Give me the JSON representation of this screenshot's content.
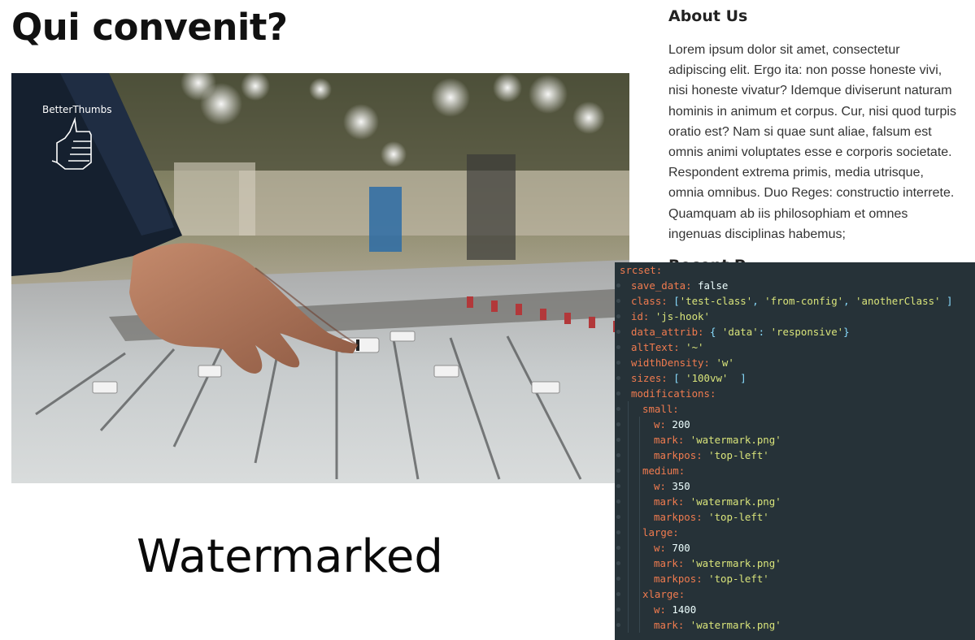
{
  "main": {
    "title": "Qui convenit?",
    "caption": "Watermarked",
    "image": {
      "watermark_label": "BetterThumbs",
      "watermark_icon": "thumbs-up-icon"
    }
  },
  "sidebar": {
    "about_title": "About Us",
    "about_text": "Lorem ipsum dolor sit amet, consectetur adipiscing elit. Ergo ita: non posse honeste vivi, nisi honeste vivatur? Idemque diviserunt naturam hominis in animum et corpus. Cur, nisi quod turpis oratio est? Nam si quae sunt aliae, falsum est omnis animi voluptates esse e corporis societate. Respondent extrema primis, media utrisque, omnia omnibus. Duo Reges: constructio interrete. Quamquam ab iis philosophiam et omnes ingenuas disciplinas habemus;",
    "second_title_partial": "Recent P"
  },
  "code": {
    "colors": {
      "background": "#263238",
      "key": "#f07b4f",
      "string": "#d9e47a",
      "punctuation": "#89ddff",
      "plain": "#eeffff"
    },
    "lines": [
      {
        "indent": 0,
        "segments": [
          {
            "t": "srcset:",
            "c": "k"
          }
        ]
      },
      {
        "indent": 1,
        "segments": [
          {
            "t": "save_data: ",
            "c": "k"
          },
          {
            "t": "false",
            "c": "v"
          }
        ]
      },
      {
        "indent": 1,
        "segments": [
          {
            "t": "class: ",
            "c": "k"
          },
          {
            "t": "[",
            "c": "p"
          },
          {
            "t": "'test-class'",
            "c": "s"
          },
          {
            "t": ", ",
            "c": "p"
          },
          {
            "t": "'from-config'",
            "c": "s"
          },
          {
            "t": ", ",
            "c": "p"
          },
          {
            "t": "'anotherClass'",
            "c": "s"
          },
          {
            "t": " ]",
            "c": "p"
          }
        ]
      },
      {
        "indent": 1,
        "segments": [
          {
            "t": "id: ",
            "c": "k"
          },
          {
            "t": "'js-hook'",
            "c": "s"
          }
        ]
      },
      {
        "indent": 1,
        "segments": [
          {
            "t": "data_attrib: ",
            "c": "k"
          },
          {
            "t": "{ ",
            "c": "p"
          },
          {
            "t": "'data'",
            "c": "s"
          },
          {
            "t": ": ",
            "c": "p"
          },
          {
            "t": "'responsive'",
            "c": "s"
          },
          {
            "t": "}",
            "c": "p"
          }
        ]
      },
      {
        "indent": 1,
        "segments": [
          {
            "t": "altText: ",
            "c": "k"
          },
          {
            "t": "'~'",
            "c": "s"
          }
        ]
      },
      {
        "indent": 1,
        "segments": [
          {
            "t": "widthDensity: ",
            "c": "k"
          },
          {
            "t": "'w'",
            "c": "s"
          }
        ]
      },
      {
        "indent": 1,
        "segments": [
          {
            "t": "sizes: ",
            "c": "k"
          },
          {
            "t": "[ ",
            "c": "p"
          },
          {
            "t": "'100vw'",
            "c": "s"
          },
          {
            "t": "  ]",
            "c": "p"
          }
        ]
      },
      {
        "indent": 1,
        "segments": [
          {
            "t": "modifications:",
            "c": "k"
          }
        ]
      },
      {
        "indent": 2,
        "segments": [
          {
            "t": "small:",
            "c": "k"
          }
        ]
      },
      {
        "indent": 3,
        "segments": [
          {
            "t": "w: ",
            "c": "k"
          },
          {
            "t": "200",
            "c": "v"
          }
        ]
      },
      {
        "indent": 3,
        "segments": [
          {
            "t": "mark: ",
            "c": "k"
          },
          {
            "t": "'watermark.png'",
            "c": "s"
          }
        ]
      },
      {
        "indent": 3,
        "segments": [
          {
            "t": "markpos: ",
            "c": "k"
          },
          {
            "t": "'top-left'",
            "c": "s"
          }
        ]
      },
      {
        "indent": 2,
        "segments": [
          {
            "t": "medium:",
            "c": "k"
          }
        ]
      },
      {
        "indent": 3,
        "segments": [
          {
            "t": "w: ",
            "c": "k"
          },
          {
            "t": "350",
            "c": "v"
          }
        ]
      },
      {
        "indent": 3,
        "segments": [
          {
            "t": "mark: ",
            "c": "k"
          },
          {
            "t": "'watermark.png'",
            "c": "s"
          }
        ]
      },
      {
        "indent": 3,
        "segments": [
          {
            "t": "markpos: ",
            "c": "k"
          },
          {
            "t": "'top-left'",
            "c": "s"
          }
        ]
      },
      {
        "indent": 2,
        "segments": [
          {
            "t": "large:",
            "c": "k"
          }
        ]
      },
      {
        "indent": 3,
        "segments": [
          {
            "t": "w: ",
            "c": "k"
          },
          {
            "t": "700",
            "c": "v"
          }
        ]
      },
      {
        "indent": 3,
        "segments": [
          {
            "t": "mark: ",
            "c": "k"
          },
          {
            "t": "'watermark.png'",
            "c": "s"
          }
        ]
      },
      {
        "indent": 3,
        "segments": [
          {
            "t": "markpos: ",
            "c": "k"
          },
          {
            "t": "'top-left'",
            "c": "s"
          }
        ]
      },
      {
        "indent": 2,
        "segments": [
          {
            "t": "xlarge:",
            "c": "k"
          }
        ]
      },
      {
        "indent": 3,
        "segments": [
          {
            "t": "w: ",
            "c": "k"
          },
          {
            "t": "1400",
            "c": "v"
          }
        ]
      },
      {
        "indent": 3,
        "segments": [
          {
            "t": "mark: ",
            "c": "k"
          },
          {
            "t": "'watermark.png'",
            "c": "s"
          }
        ]
      }
    ]
  }
}
